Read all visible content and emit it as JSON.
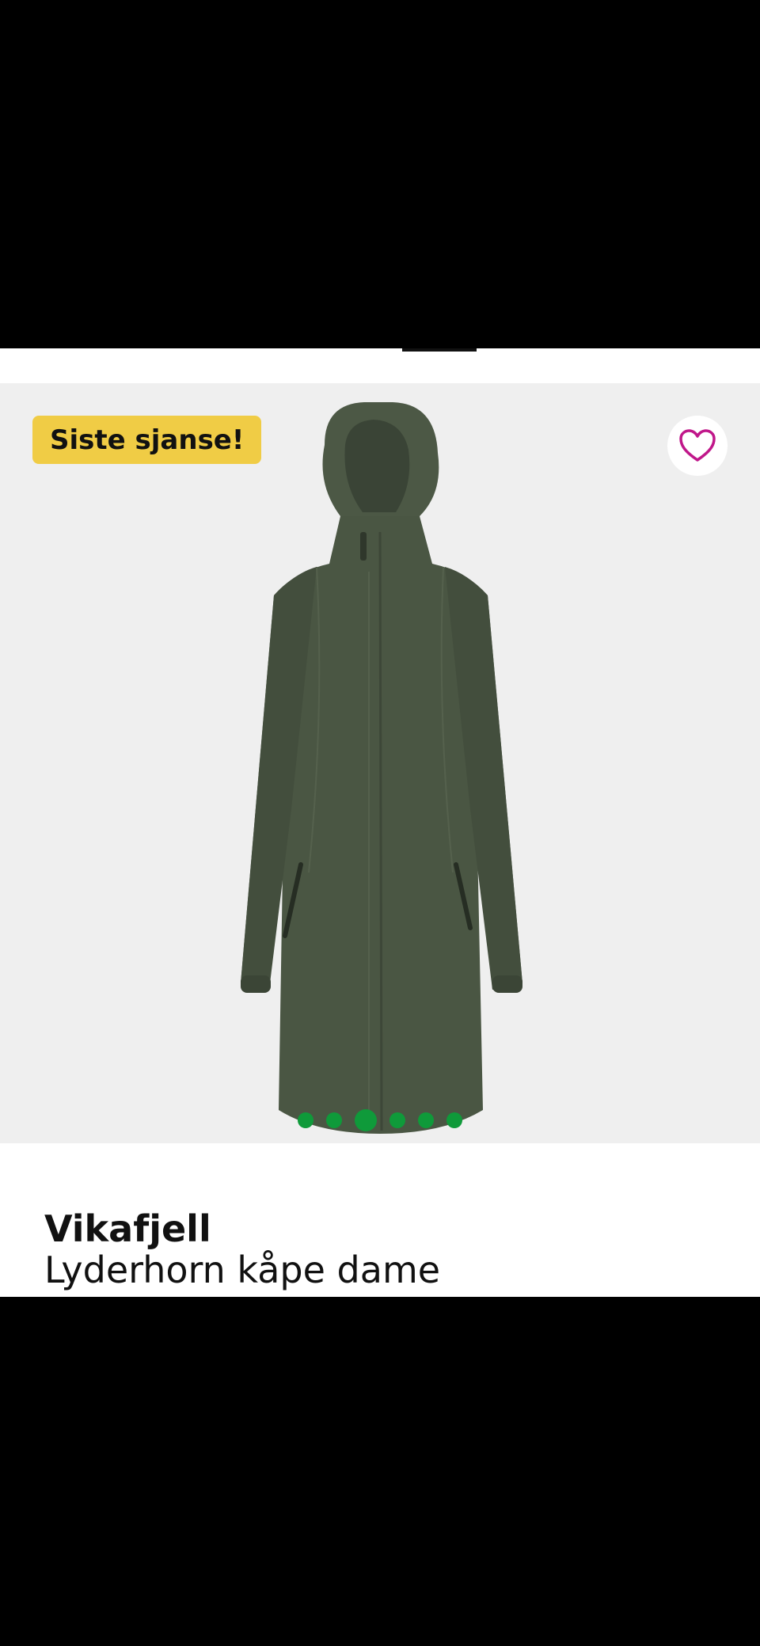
{
  "product": {
    "badge": "Siste sjanse!",
    "brand": "Vikafjell",
    "name": "Lyderhorn kåpe dame"
  },
  "gallery": {
    "image_count": 6,
    "active_index": 2,
    "image_subject": "dark green hooded women's coat"
  },
  "icons": {
    "favorite": "heart-outline-icon"
  },
  "colors": {
    "badge_bg": "#f0cc45",
    "dot": "#0f9a3a",
    "heart": "#c0178a",
    "coat": "#4a5643",
    "gallery_bg": "#efefef"
  }
}
